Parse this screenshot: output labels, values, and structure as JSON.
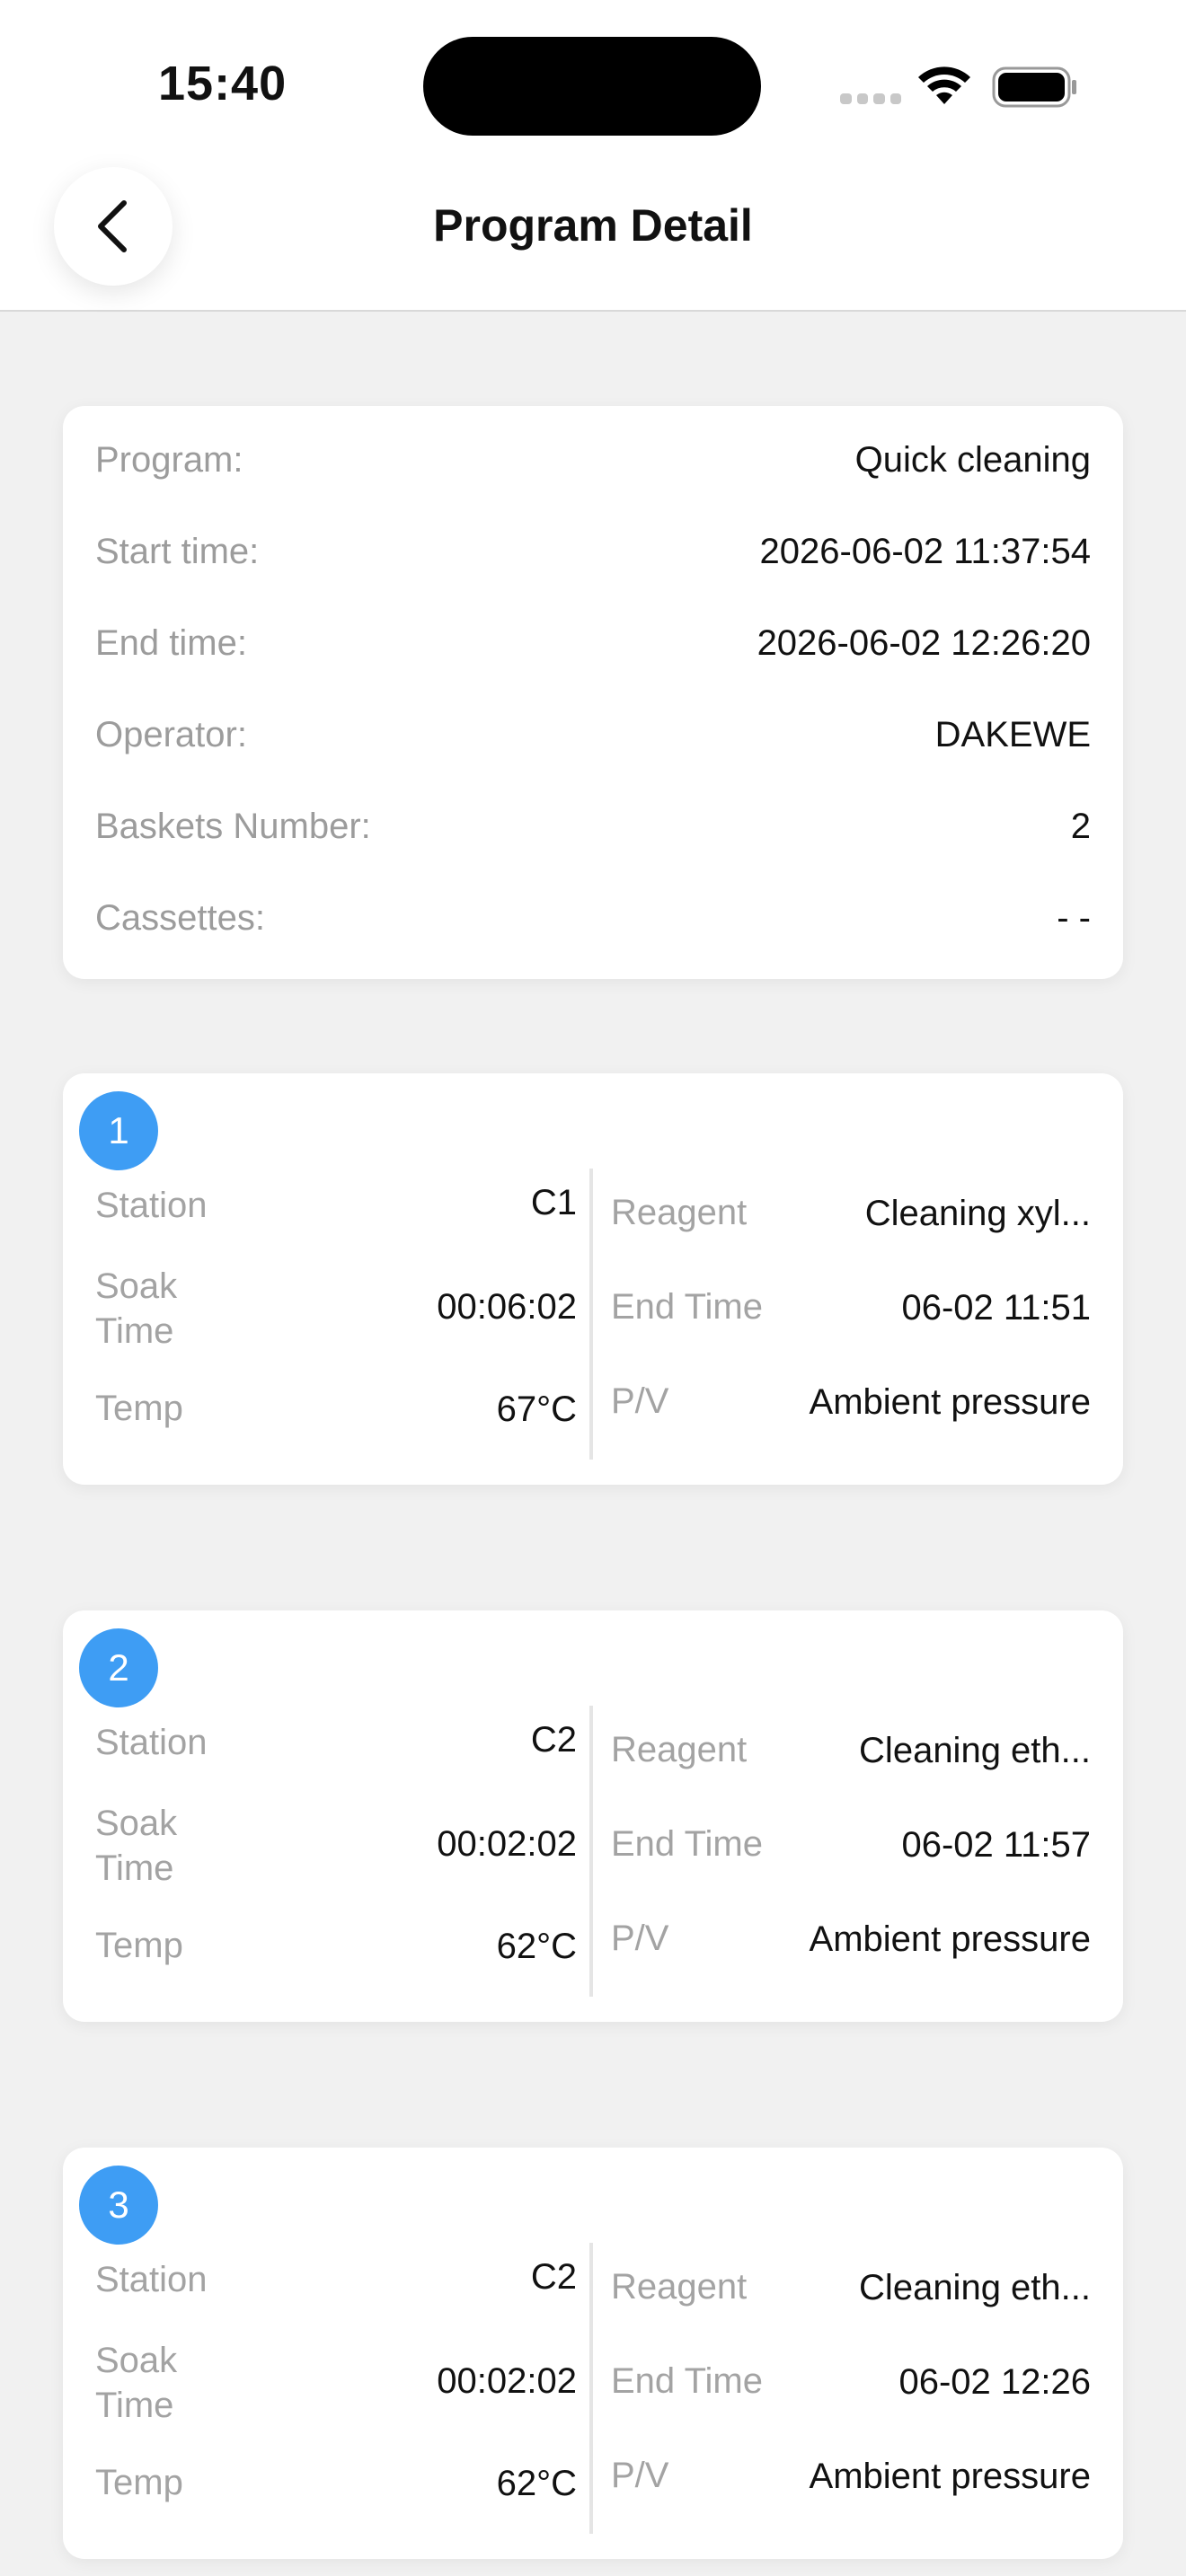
{
  "status_bar": {
    "time": "15:40"
  },
  "header": {
    "title": "Program Detail",
    "back_icon": "chevron-left-icon"
  },
  "summary": {
    "rows": [
      {
        "label": "Program:",
        "value": "Quick cleaning"
      },
      {
        "label": "Start time:",
        "value": "2026-06-02 11:37:54"
      },
      {
        "label": "End time:",
        "value": "2026-06-02 12:26:20"
      },
      {
        "label": "Operator:",
        "value": "DAKEWE"
      },
      {
        "label": "Baskets Number:",
        "value": "2"
      },
      {
        "label": "Cassettes:",
        "value": "- -"
      }
    ]
  },
  "steps": [
    {
      "number": "1",
      "station_label": "Station",
      "station": "C1",
      "soak_label": "Soak\nTime",
      "soak": "00:06:02",
      "temp_label": "Temp",
      "temp": "67°C",
      "reagent_label": "Reagent",
      "reagent": "Cleaning xyl...",
      "end_label": "End Time",
      "end": "06-02 11:51",
      "pv_label": "P/V",
      "pv": "Ambient pressure"
    },
    {
      "number": "2",
      "station_label": "Station",
      "station": "C2",
      "soak_label": "Soak\nTime",
      "soak": "00:02:02",
      "temp_label": "Temp",
      "temp": "62°C",
      "reagent_label": "Reagent",
      "reagent": "Cleaning eth...",
      "end_label": "End Time",
      "end": "06-02 11:57",
      "pv_label": "P/V",
      "pv": "Ambient pressure"
    },
    {
      "number": "3",
      "station_label": "Station",
      "station": "C2",
      "soak_label": "Soak\nTime",
      "soak": "00:02:02",
      "temp_label": "Temp",
      "temp": "62°C",
      "reagent_label": "Reagent",
      "reagent": "Cleaning eth...",
      "end_label": "End Time",
      "end": "06-02 12:26",
      "pv_label": "P/V",
      "pv": "Ambient pressure"
    }
  ],
  "colors": {
    "accent": "#3e9df4",
    "page_bg": "#f1f1f1",
    "label_gray": "#9c9c9c"
  }
}
